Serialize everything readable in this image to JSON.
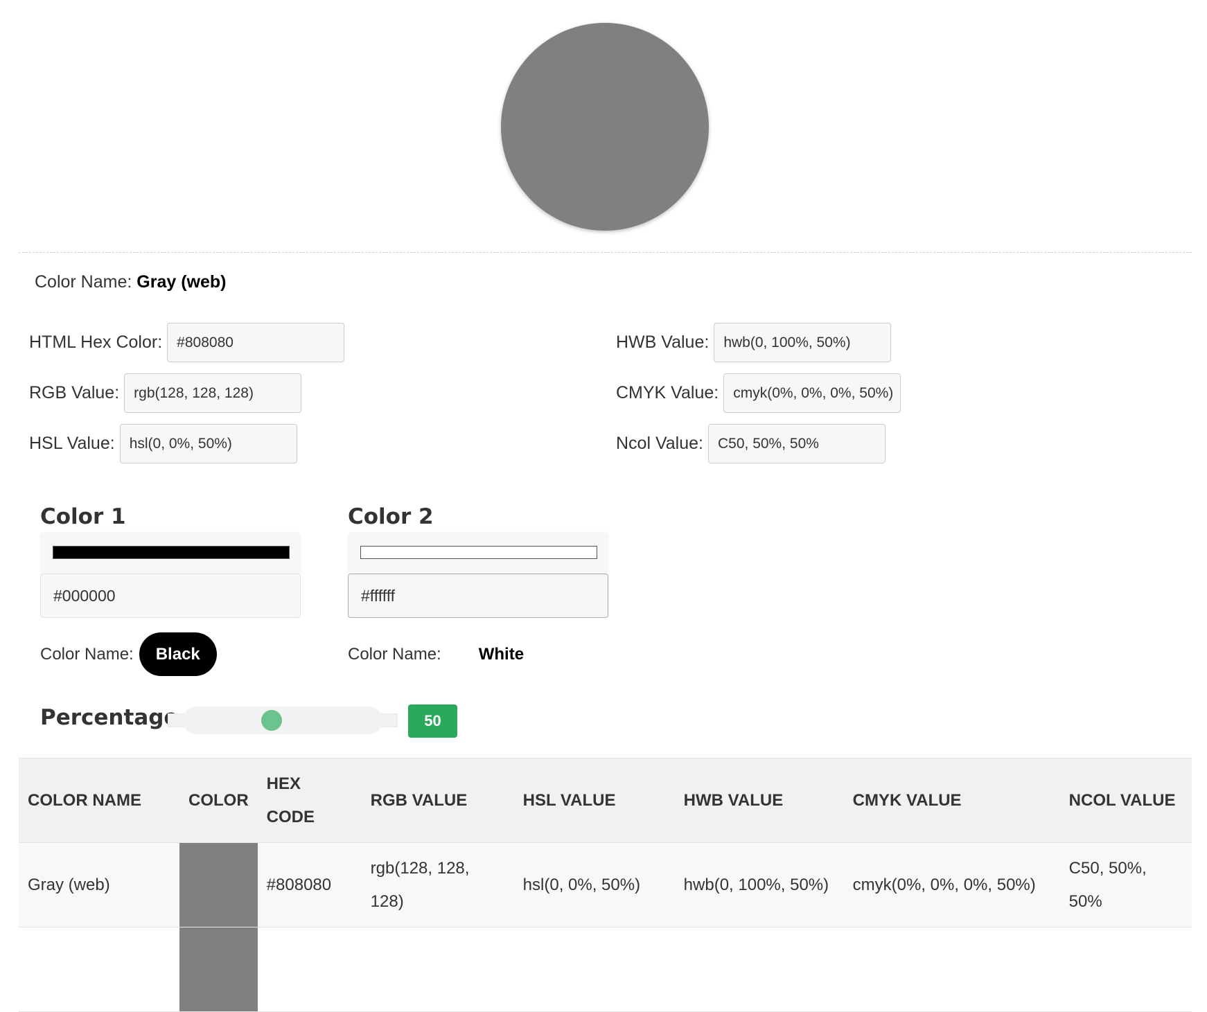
{
  "color": {
    "hex_value": "#808080",
    "name_label": "Color Name:",
    "name": "Gray (web)"
  },
  "fields": [
    {
      "label": "HTML Hex Color:",
      "value": "#808080"
    },
    {
      "label": "RGB Value:",
      "value": "rgb(128, 128, 128)"
    },
    {
      "label": "HSL Value:",
      "value": "hsl(0, 0%, 50%)"
    },
    {
      "label": "HWB Value:",
      "value": "hwb(0, 100%, 50%)"
    },
    {
      "label": "CMYK Value:",
      "value": "cmyk(0%, 0%, 0%, 50%)"
    },
    {
      "label": "Ncol Value:",
      "value": "C50, 50%, 50%"
    }
  ],
  "mixer": {
    "color1": {
      "heading": "Color 1",
      "swatch": "#000000",
      "hex": "#000000",
      "name_label": "Color Name:",
      "name": "Black"
    },
    "color2": {
      "heading": "Color 2",
      "swatch": "#ffffff",
      "hex": "#ffffff",
      "name_label": "Color Name:",
      "name": "White"
    },
    "percentage": {
      "label": "Percentage",
      "value": "50",
      "fraction": 0.5
    },
    "accent": "#2aa95a"
  },
  "table": {
    "headers": [
      "COLOR NAME",
      "COLOR",
      "HEX CODE",
      "RGB VALUE",
      "HSL VALUE",
      "HWB VALUE",
      "CMYK VALUE",
      "NCOL VALUE"
    ],
    "rows": [
      {
        "name": "Gray (web)",
        "swatch": "#808080",
        "hex": "#808080",
        "rgb": "rgb(128, 128, 128)",
        "hsl": "hsl(0, 0%, 50%)",
        "hwb": "hwb(0, 100%, 50%)",
        "cmyk": "cmyk(0%, 0%, 0%, 50%)",
        "ncol": "C50, 50%, 50%"
      }
    ]
  }
}
